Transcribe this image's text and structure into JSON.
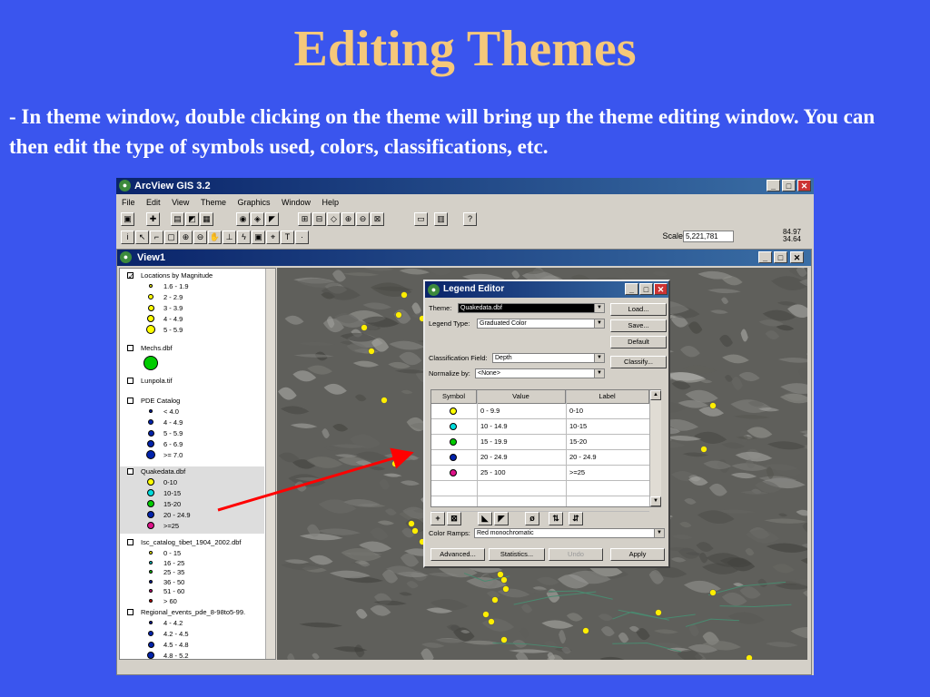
{
  "slide": {
    "title": "Editing Themes",
    "body": "- In theme window, double clicking on the theme will bring up the theme editing window.  You can then edit the type of symbols used, colors, classifications, etc."
  },
  "app": {
    "title": "ArcView GIS 3.2",
    "menus": [
      "File",
      "Edit",
      "View",
      "Theme",
      "Graphics",
      "Window",
      "Help"
    ],
    "scale_label": "Scale 1:",
    "scale_value": "5,221,781",
    "coord_x": "84.97",
    "coord_y": "34.64"
  },
  "view": {
    "title": "View1",
    "themes": [
      {
        "name": "Locations by Magnitude",
        "checked": true,
        "classes": [
          {
            "label": "1.6 - 1.9",
            "color": "#ffff00",
            "size": 4
          },
          {
            "label": "2 - 2.9",
            "color": "#ffff00",
            "size": 6
          },
          {
            "label": "3 - 3.9",
            "color": "#ffff00",
            "size": 7
          },
          {
            "label": "4 - 4.9",
            "color": "#ffff00",
            "size": 8
          },
          {
            "label": "5 - 5.9",
            "color": "#ffff00",
            "size": 10
          }
        ]
      },
      {
        "name": "Mechs.dbf",
        "checked": false,
        "classes": [
          {
            "label": "",
            "color": "#00cc00",
            "size": 16
          }
        ]
      },
      {
        "name": "Lunpola.tif",
        "checked": false,
        "classes": []
      },
      {
        "name": "PDE Catalog",
        "checked": false,
        "classes": [
          {
            "label": "< 4.0",
            "color": "#0022aa",
            "size": 4
          },
          {
            "label": "4 - 4.9",
            "color": "#0022aa",
            "size": 6
          },
          {
            "label": "5 - 5.9",
            "color": "#0022aa",
            "size": 7
          },
          {
            "label": "6 - 6.9",
            "color": "#0022aa",
            "size": 8
          },
          {
            "label": ">= 7.0",
            "color": "#0022aa",
            "size": 10
          }
        ]
      },
      {
        "name": "Quakedata.dbf",
        "checked": false,
        "active": true,
        "classes": [
          {
            "label": "0-10",
            "color": "#ffff00",
            "size": 8
          },
          {
            "label": "10-15",
            "color": "#00dddd",
            "size": 8
          },
          {
            "label": "15-20",
            "color": "#00cc00",
            "size": 8
          },
          {
            "label": "20 - 24.9",
            "color": "#0022aa",
            "size": 8
          },
          {
            "label": ">=25",
            "color": "#dd1188",
            "size": 8
          }
        ]
      },
      {
        "name": "Isc_catalog_tibet_1904_2002.dbf",
        "checked": false,
        "classes": [
          {
            "label": "0 - 15",
            "color": "#ffff00",
            "size": 4
          },
          {
            "label": "16 - 25",
            "color": "#00cccc",
            "size": 4
          },
          {
            "label": "25 - 35",
            "color": "#00cc00",
            "size": 4
          },
          {
            "label": "36 - 50",
            "color": "#0022aa",
            "size": 4
          },
          {
            "label": "51 - 60",
            "color": "#cc1177",
            "size": 4
          },
          {
            "label": "> 60",
            "color": "#cc0000",
            "size": 4
          }
        ]
      },
      {
        "name": "Regional_events_pde_8-98to5-99.",
        "checked": false,
        "classes": [
          {
            "label": "4 - 4.2",
            "color": "#0022aa",
            "size": 4
          },
          {
            "label": "4.2 - 4.5",
            "color": "#0022aa",
            "size": 6
          },
          {
            "label": "4.5 - 4.8",
            "color": "#0022aa",
            "size": 7
          },
          {
            "label": "4.8 - 5.2",
            "color": "#0022aa",
            "size": 8
          }
        ]
      }
    ]
  },
  "legend_editor": {
    "title": "Legend Editor",
    "theme_label": "Theme:",
    "theme_value": "Quakedata.dbf",
    "legend_type_label": "Legend Type:",
    "legend_type_value": "Graduated Color",
    "class_field_label": "Classification Field:",
    "class_field_value": "Depth",
    "normalize_label": "Normalize by:",
    "normalize_value": "<None>",
    "btn_load": "Load...",
    "btn_save": "Save...",
    "btn_default": "Default",
    "btn_classify": "Classify...",
    "col_symbol": "Symbol",
    "col_value": "Value",
    "col_label": "Label",
    "rows": [
      {
        "value": "0 - 9.9",
        "label": "0-10",
        "color": "#ffff00"
      },
      {
        "value": "10 - 14.9",
        "label": "10-15",
        "color": "#00dddd"
      },
      {
        "value": "15 - 19.9",
        "label": "15-20",
        "color": "#00cc00"
      },
      {
        "value": "20 - 24.9",
        "label": "20 - 24.9",
        "color": "#0022aa"
      },
      {
        "value": "25 - 100",
        "label": ">=25",
        "color": "#dd1188"
      }
    ],
    "color_ramps_label": "Color Ramps:",
    "color_ramps_value": "Red monochromatic",
    "btn_advanced": "Advanced...",
    "btn_statistics": "Statistics...",
    "btn_undo": "Undo",
    "btn_apply": "Apply"
  },
  "colors": {
    "slide_bg": "#3a55ee",
    "title": "#f5c87a",
    "arrow": "#ff0000",
    "quake_point": "#ffee00"
  }
}
